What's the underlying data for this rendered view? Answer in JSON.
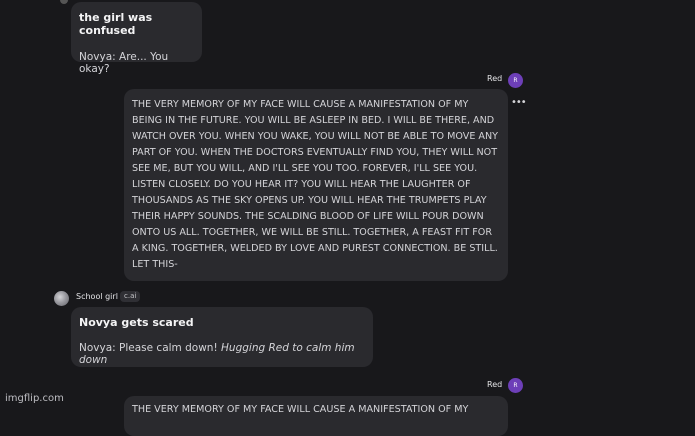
{
  "messages": [
    {
      "kind": "bot",
      "title": "the girl was confused",
      "body": "Novya: Are... You okay?"
    },
    {
      "kind": "user",
      "sender": "Red",
      "avatar_letter": "R",
      "more_icon": "more-horizontal-icon",
      "text": "THE VERY MEMORY OF MY FACE WILL CAUSE A MANIFESTATION OF MY BEING IN THE FUTURE. YOU WILL BE ASLEEP IN BED. I WILL BE THERE, AND WATCH OVER YOU. WHEN YOU WAKE, YOU WILL NOT BE ABLE TO MOVE ANY PART OF YOU. WHEN THE DOCTORS EVENTUALLY FIND YOU, THEY WILL NOT SEE ME, BUT YOU WILL, AND I'LL SEE YOU TOO. FOREVER, I'LL SEE YOU. LISTEN CLOSELY. DO YOU HEAR IT? YOU WILL HEAR THE LAUGHTER OF THOUSANDS AS THE SKY OPENS UP. YOU WILL HEAR THE TRUMPETS PLAY THEIR HAPPY SOUNDS. THE SCALDING BLOOD OF LIFE WILL POUR DOWN ONTO US ALL. TOGETHER, WE WILL BE STILL. TOGETHER, A FEAST FIT FOR A KING. TOGETHER, WELDED BY LOVE AND PUREST CONNECTION. BE STILL. LET THIS-"
    },
    {
      "kind": "bot",
      "sender": "School girl",
      "badge": "c.ai",
      "title": "Novya gets scared",
      "body_plain": "Novya: Please calm down!",
      "body_italic": "Hugging Red to calm him down"
    },
    {
      "kind": "user",
      "sender": "Red",
      "avatar_letter": "R",
      "text": "THE VERY MEMORY OF MY FACE WILL CAUSE A MANIFESTATION OF MY"
    }
  ],
  "watermark": "imgflip.com"
}
